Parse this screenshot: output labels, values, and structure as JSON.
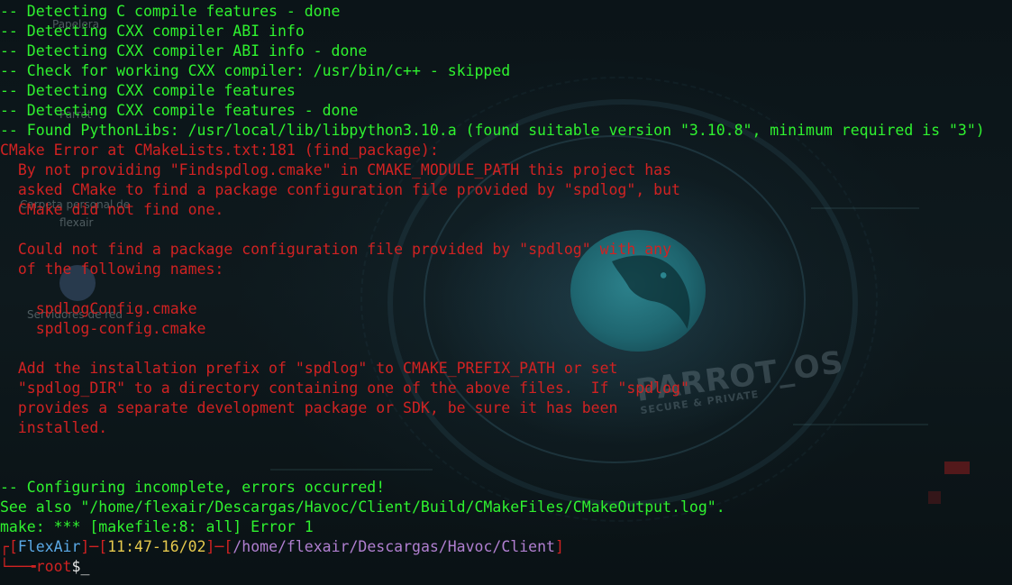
{
  "terminal": {
    "lines": [
      {
        "text": "-- Detecting C compile features - done",
        "color": "#2ff22f"
      },
      {
        "text": "-- Detecting CXX compiler ABI info",
        "color": "#2ff22f"
      },
      {
        "text": "-- Detecting CXX compiler ABI info - done",
        "color": "#2ff22f"
      },
      {
        "text": "-- Check for working CXX compiler: /usr/bin/c++ - skipped",
        "color": "#2ff22f"
      },
      {
        "text": "-- Detecting CXX compile features",
        "color": "#2ff22f"
      },
      {
        "text": "-- Detecting CXX compile features - done",
        "color": "#2ff22f"
      },
      {
        "text": "-- Found PythonLibs: /usr/local/lib/libpython3.10.a (found suitable version \"3.10.8\", minimum required is \"3\")",
        "color": "#2ff22f"
      },
      {
        "text": "CMake Error at CMakeLists.txt:181 (find_package):",
        "color": "#d12222"
      },
      {
        "text": "  By not providing \"Findspdlog.cmake\" in CMAKE_MODULE_PATH this project has",
        "color": "#d12222"
      },
      {
        "text": "  asked CMake to find a package configuration file provided by \"spdlog\", but",
        "color": "#d12222"
      },
      {
        "text": "  CMake did not find one.",
        "color": "#d12222"
      },
      {
        "text": "",
        "color": "#d12222"
      },
      {
        "text": "  Could not find a package configuration file provided by \"spdlog\" with any",
        "color": "#d12222"
      },
      {
        "text": "  of the following names:",
        "color": "#d12222"
      },
      {
        "text": "",
        "color": "#d12222"
      },
      {
        "text": "    spdlogConfig.cmake",
        "color": "#d12222"
      },
      {
        "text": "    spdlog-config.cmake",
        "color": "#d12222"
      },
      {
        "text": "",
        "color": "#d12222"
      },
      {
        "text": "  Add the installation prefix of \"spdlog\" to CMAKE_PREFIX_PATH or set",
        "color": "#d12222"
      },
      {
        "text": "  \"spdlog_DIR\" to a directory containing one of the above files.  If \"spdlog\"",
        "color": "#d12222"
      },
      {
        "text": "  provides a separate development package or SDK, be sure it has been",
        "color": "#d12222"
      },
      {
        "text": "  installed.",
        "color": "#d12222"
      },
      {
        "text": "",
        "color": "#d12222"
      },
      {
        "text": "",
        "color": "#d12222"
      },
      {
        "text": "-- Configuring incomplete, errors occurred!",
        "color": "#2ff22f"
      },
      {
        "text": "See also \"/home/flexair/Descargas/Havoc/Client/Build/CMakeFiles/CMakeOutput.log\".",
        "color": "#2ff22f"
      },
      {
        "text": "make: *** [makefile:8: all] Error 1",
        "color": "#2ff22f"
      }
    ],
    "prompt": {
      "corner_top": "┌",
      "open1": "[",
      "host": "FlexAir",
      "close1": "]",
      "dash1": "─",
      "open2": "[",
      "time": "11:47-16/02",
      "close2": "]",
      "dash2": "─",
      "open3": "[",
      "path": "/home/flexair/Descargas/Havoc/Client",
      "close3": "]",
      "corner_bottom": "└──╼",
      "user": "root",
      "symbol": "$",
      "cursor": "_"
    }
  },
  "wallpaper": {
    "brand": "PARROT_OS",
    "brand_sub": "SECURE & PRIVATE",
    "desktop_icons": [
      {
        "label": "Papelera"
      },
      {
        "label": "Parrot"
      },
      {
        "label": "Carpeta personal de"
      },
      {
        "label": "flexair"
      },
      {
        "label": "Servidores de red"
      }
    ]
  },
  "colors": {
    "success": "#2ff22f",
    "error": "#d12222",
    "prompt_host": "#5aa9e6",
    "prompt_time": "#e6c94d",
    "prompt_path": "#b07fd0"
  }
}
